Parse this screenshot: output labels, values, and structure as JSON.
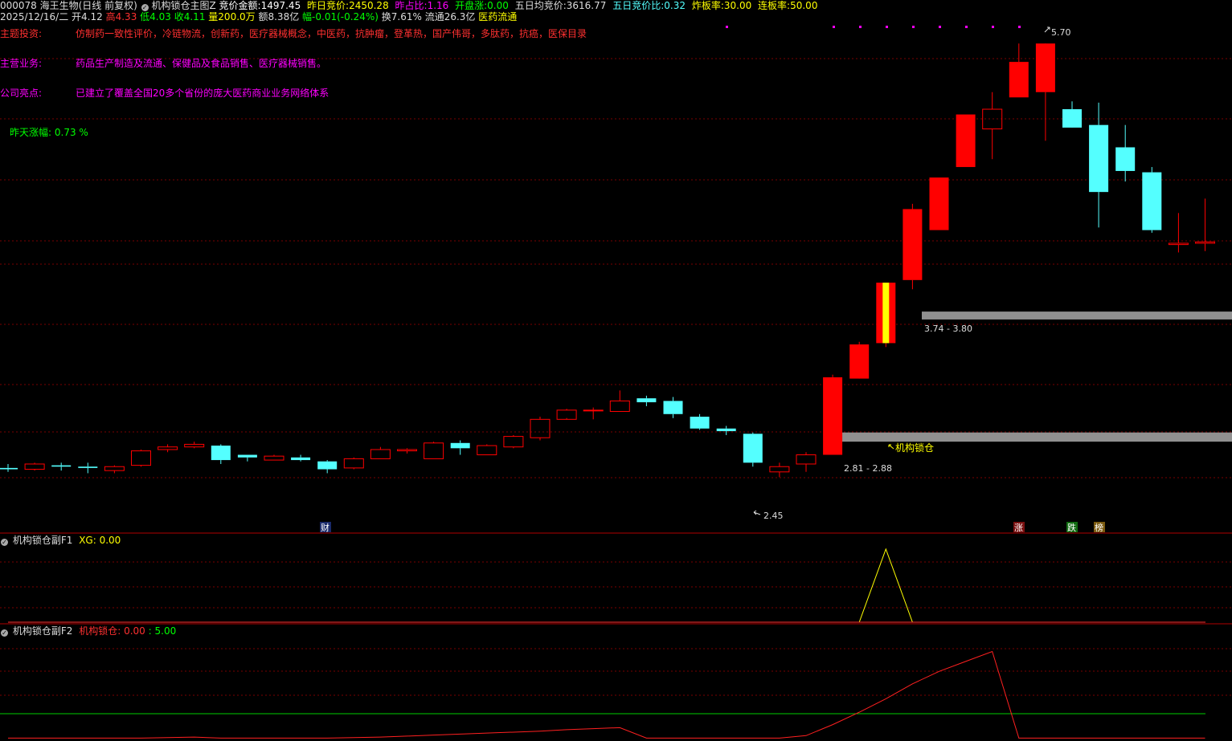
{
  "header": {
    "code_name": "000078 海王生物(日线 前复权)",
    "indicator_name": "机构锁仓主图Z",
    "auction_amount_label": "竞价金额:",
    "auction_amount_value": "1497.45",
    "prev_auction_label": "昨日竞价:",
    "prev_auction_value": "2450.28",
    "prev_ratio_label": "昨占比:",
    "prev_ratio_value": "1.16",
    "open_rise_label": "开盘涨:",
    "open_rise_value": "0.00",
    "avg5_auction_label": "五日均竞价:",
    "avg5_auction_value": "3616.77",
    "ratio5_label": "五日竞价比:",
    "ratio5_value": "0.32",
    "break_rate_label": "炸板率:",
    "break_rate_value": "30.00",
    "streak_rate_label": "连板率:",
    "streak_rate_value": "50.00"
  },
  "quote": {
    "date": "2025/12/16/二",
    "open": "开4.12",
    "high": "高4.33",
    "low": "低4.03",
    "close": "收4.11",
    "volume": "量200.0万",
    "amount": "额8.38亿",
    "change": "幅-0.01(-0.24%)",
    "turnover": "换7.61%",
    "float": "流通26.3亿",
    "sector": "医药流通"
  },
  "info": {
    "theme_label": "主题投资:",
    "theme_value": "仿制药一致性评价，冷链物流，创新药，医疗器械概念，中医药，抗肿瘤，登革热，国产伟哥，多肽药，抗癌，医保目录",
    "business_label": "主营业务:",
    "business_value": "药品生产制造及流通、保健品及食品销售、医疗器械销售。",
    "highlight_label": "公司亮点:",
    "highlight_value": "已建立了覆盖全国20多个省份的庞大医药商业业务网络体系",
    "yesterday_label": "昨天涨幅:",
    "yesterday_value": "0.73 %"
  },
  "annotations": {
    "high_label": "5.70",
    "low_label": "2.45",
    "band_upper": "3.74 - 3.80",
    "band_lower": "2.81 - 2.88",
    "lock_label": "机构锁仓",
    "badge_cai": "财",
    "badge_zhang": "涨",
    "badge_die": "跌",
    "badge_bang": "榜"
  },
  "panel1": {
    "title": "机构锁仓副F1",
    "xg_label": "XG:",
    "xg_value": "0.00"
  },
  "panel2": {
    "title": "机构锁仓副F2",
    "lock_label": "机构锁仓:",
    "lock_value": "0.00",
    "sep": ":",
    "level_value": "5.00"
  },
  "colors": {
    "up": "#ff0000",
    "down": "#54ffff",
    "grid": "#7a0000",
    "band": "#909090",
    "yellow": "#ffff00",
    "green": "#00ff00",
    "magenta": "#ff00ff"
  },
  "chart_data": {
    "type": "candlestick",
    "price_ylim": [
      2.2,
      6.0
    ],
    "candles": [
      {
        "o": 2.61,
        "h": 2.64,
        "l": 2.58,
        "c": 2.6
      },
      {
        "o": 2.6,
        "h": 2.65,
        "l": 2.59,
        "c": 2.64
      },
      {
        "o": 2.63,
        "h": 2.65,
        "l": 2.59,
        "c": 2.62
      },
      {
        "o": 2.62,
        "h": 2.65,
        "l": 2.57,
        "c": 2.61
      },
      {
        "o": 2.59,
        "h": 2.63,
        "l": 2.57,
        "c": 2.62
      },
      {
        "o": 2.63,
        "h": 2.75,
        "l": 2.62,
        "c": 2.74
      },
      {
        "o": 2.75,
        "h": 2.79,
        "l": 2.73,
        "c": 2.77
      },
      {
        "o": 2.77,
        "h": 2.81,
        "l": 2.76,
        "c": 2.79
      },
      {
        "o": 2.78,
        "h": 2.79,
        "l": 2.64,
        "c": 2.67
      },
      {
        "o": 2.71,
        "h": 2.71,
        "l": 2.66,
        "c": 2.69
      },
      {
        "o": 2.67,
        "h": 2.71,
        "l": 2.67,
        "c": 2.7
      },
      {
        "o": 2.69,
        "h": 2.71,
        "l": 2.66,
        "c": 2.67
      },
      {
        "o": 2.66,
        "h": 2.67,
        "l": 2.57,
        "c": 2.6
      },
      {
        "o": 2.61,
        "h": 2.69,
        "l": 2.6,
        "c": 2.68
      },
      {
        "o": 2.68,
        "h": 2.77,
        "l": 2.68,
        "c": 2.75
      },
      {
        "o": 2.74,
        "h": 2.76,
        "l": 2.72,
        "c": 2.75
      },
      {
        "o": 2.68,
        "h": 2.81,
        "l": 2.68,
        "c": 2.8
      },
      {
        "o": 2.8,
        "h": 2.82,
        "l": 2.71,
        "c": 2.76
      },
      {
        "o": 2.71,
        "h": 2.79,
        "l": 2.71,
        "c": 2.78
      },
      {
        "o": 2.77,
        "h": 2.86,
        "l": 2.76,
        "c": 2.85
      },
      {
        "o": 2.84,
        "h": 3.0,
        "l": 2.82,
        "c": 2.98
      },
      {
        "o": 2.98,
        "h": 3.06,
        "l": 2.99,
        "c": 3.05
      },
      {
        "o": 3.05,
        "h": 3.07,
        "l": 2.98,
        "c": 3.05
      },
      {
        "o": 3.04,
        "h": 3.2,
        "l": 3.04,
        "c": 3.12
      },
      {
        "o": 3.14,
        "h": 3.16,
        "l": 3.08,
        "c": 3.11
      },
      {
        "o": 3.12,
        "h": 3.15,
        "l": 2.99,
        "c": 3.02
      },
      {
        "o": 3.0,
        "h": 3.02,
        "l": 2.9,
        "c": 2.91
      },
      {
        "o": 2.91,
        "h": 2.93,
        "l": 2.86,
        "c": 2.89
      },
      {
        "o": 2.87,
        "h": 2.88,
        "l": 2.62,
        "c": 2.65
      },
      {
        "o": 2.58,
        "h": 2.65,
        "l": 2.54,
        "c": 2.62
      },
      {
        "o": 2.64,
        "h": 2.73,
        "l": 2.58,
        "c": 2.71
      },
      {
        "o": 2.71,
        "h": 3.32,
        "l": 2.71,
        "c": 3.3
      },
      {
        "o": 3.29,
        "h": 3.57,
        "l": 3.38,
        "c": 3.55
      },
      {
        "o": 3.56,
        "h": 4.02,
        "l": 3.53,
        "c": 4.02
      },
      {
        "o": 4.04,
        "h": 4.62,
        "l": 3.97,
        "c": 4.58
      },
      {
        "o": 4.42,
        "h": 4.82,
        "l": 4.42,
        "c": 4.82
      },
      {
        "o": 4.9,
        "h": 5.3,
        "l": 4.9,
        "c": 5.3
      },
      {
        "o": 5.19,
        "h": 5.47,
        "l": 4.96,
        "c": 5.34
      },
      {
        "o": 5.43,
        "h": 5.84,
        "l": 5.43,
        "c": 5.7
      },
      {
        "o": 5.47,
        "h": 5.8,
        "l": 5.1,
        "c": 5.84
      },
      {
        "o": 5.34,
        "h": 5.4,
        "l": 5.23,
        "c": 5.2
      },
      {
        "o": 5.22,
        "h": 5.39,
        "l": 4.44,
        "c": 4.71
      },
      {
        "o": 5.05,
        "h": 5.22,
        "l": 4.79,
        "c": 4.87
      },
      {
        "o": 4.86,
        "h": 4.9,
        "l": 4.4,
        "c": 4.42
      },
      {
        "o": 4.31,
        "h": 4.55,
        "l": 4.25,
        "c": 4.32
      },
      {
        "o": 4.32,
        "h": 4.66,
        "l": 4.26,
        "c": 4.33
      }
    ],
    "bands": [
      {
        "low": 3.74,
        "high": 3.8,
        "label": "3.74 - 3.80"
      },
      {
        "low": 2.81,
        "high": 2.88,
        "label": "2.81 - 2.88"
      }
    ],
    "f1_xg": [
      0,
      0,
      0,
      0,
      0,
      0,
      0,
      0,
      0,
      0,
      0,
      0,
      0,
      0,
      0,
      0,
      0,
      0,
      0,
      0,
      0,
      0,
      0,
      0,
      0,
      0,
      0,
      0,
      0,
      0,
      0,
      0,
      0,
      1,
      0,
      0,
      0,
      0,
      0,
      0,
      0,
      0,
      0,
      0,
      0,
      0
    ],
    "f2_lock": [
      0.1,
      0.1,
      0.1,
      0.1,
      0.1,
      0.1,
      0.2,
      0.3,
      0.1,
      0.1,
      0.1,
      0.1,
      0.1,
      0.2,
      0.3,
      0.5,
      0.7,
      0.9,
      1.1,
      1.3,
      1.5,
      1.8,
      2.0,
      2.2,
      0.1,
      0.1,
      0.1,
      0.1,
      0.1,
      0.1,
      0.6,
      2.8,
      5.3,
      8.0,
      11.0,
      13.5,
      15.5,
      17.5,
      0.1,
      0.1,
      0.1,
      0.1,
      0.1,
      0.1,
      0.1,
      0.1
    ],
    "f2_level": 5.0,
    "f2_ylim": [
      0,
      20
    ]
  }
}
